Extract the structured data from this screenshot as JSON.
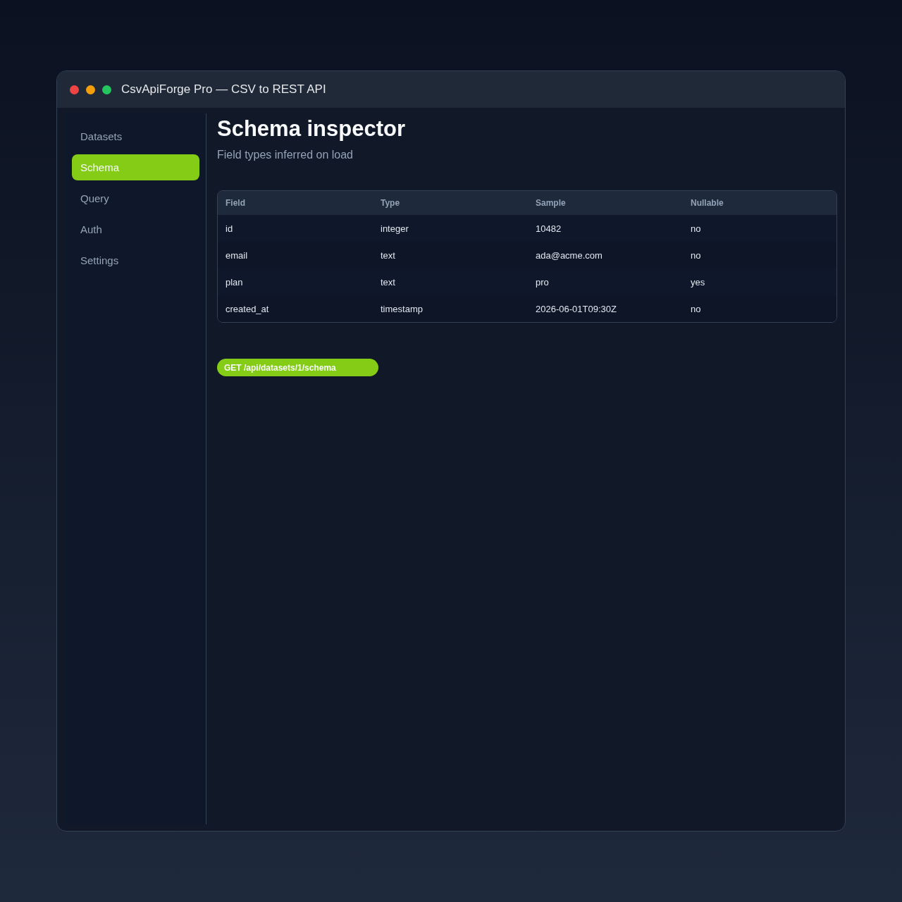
{
  "window": {
    "title": "CsvApiForge Pro — CSV to REST API"
  },
  "sidebar": {
    "items": [
      {
        "label": "Datasets",
        "selected": false
      },
      {
        "label": "Schema",
        "selected": true
      },
      {
        "label": "Query",
        "selected": false
      },
      {
        "label": "Auth",
        "selected": false
      },
      {
        "label": "Settings",
        "selected": false
      }
    ]
  },
  "page": {
    "title": "Schema inspector",
    "subtitle": "Field types inferred on load"
  },
  "table": {
    "columns": [
      "Field",
      "Type",
      "Sample",
      "Nullable"
    ],
    "rows": [
      [
        "id",
        "integer",
        "10482",
        "no"
      ],
      [
        "email",
        "text",
        "ada@acme.com",
        "no"
      ],
      [
        "plan",
        "text",
        "pro",
        "yes"
      ],
      [
        "created_at",
        "timestamp",
        "2026-06-01T09:30Z",
        "no"
      ]
    ]
  },
  "endpoint": {
    "label": "GET /api/datasets/1/schema"
  }
}
